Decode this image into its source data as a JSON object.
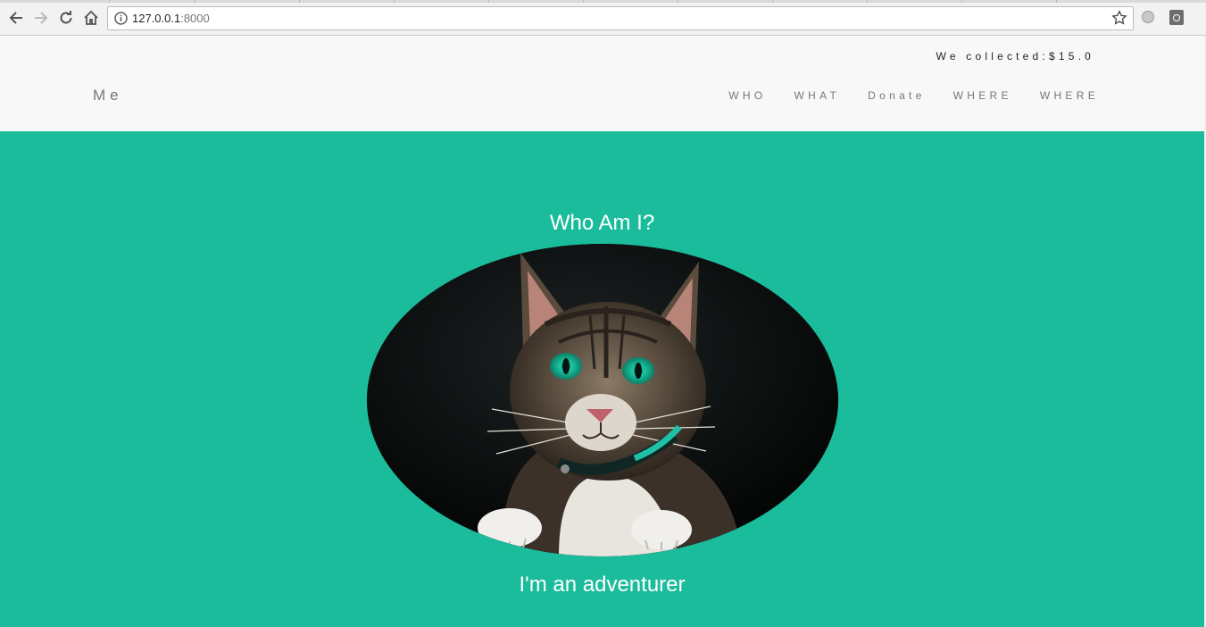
{
  "browser": {
    "url_host": "127.0.0.1",
    "url_port": ":8000"
  },
  "header": {
    "collected_text": "We collected:$15.0",
    "brand": "Me",
    "nav": [
      {
        "label": "WHO"
      },
      {
        "label": "WHAT"
      },
      {
        "label": "Donate"
      },
      {
        "label": "WHERE"
      },
      {
        "label": "WHERE"
      }
    ]
  },
  "hero": {
    "title": "Who Am I?",
    "caption": "I'm an adventurer",
    "image_icon": "cat-photo"
  },
  "colors": {
    "accent": "#1bbc9b",
    "header_bg": "#f8f8f8",
    "nav_text": "#777777"
  }
}
